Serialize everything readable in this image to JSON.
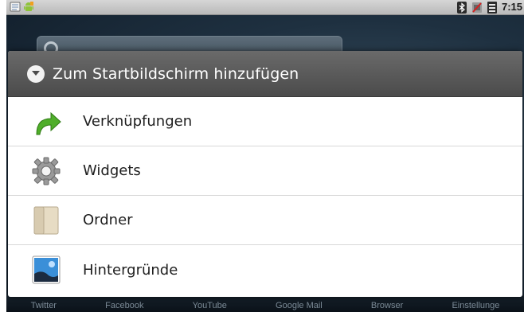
{
  "status_bar": {
    "time": "7:15",
    "left_icons": [
      "notes-icon",
      "android-icon"
    ],
    "right_icons": [
      "bluetooth-icon",
      "no-sim-icon",
      "wifi-icon"
    ]
  },
  "home": {
    "dock_labels": [
      "Twitter",
      "Facebook",
      "YouTube",
      "Google Mail",
      "Browser",
      "Einstellunge"
    ]
  },
  "dialog": {
    "title": "Zum Startbildschirm hinzufügen",
    "items": [
      {
        "label": "Verknüpfungen",
        "icon": "green-arrow-icon"
      },
      {
        "label": "Widgets",
        "icon": "gear-icon"
      },
      {
        "label": "Ordner",
        "icon": "folder-icon"
      },
      {
        "label": "Hintergründe",
        "icon": "wallpaper-icon"
      }
    ]
  },
  "colors": {
    "header_bg": "#555555",
    "accent_green": "#4fae2a"
  }
}
